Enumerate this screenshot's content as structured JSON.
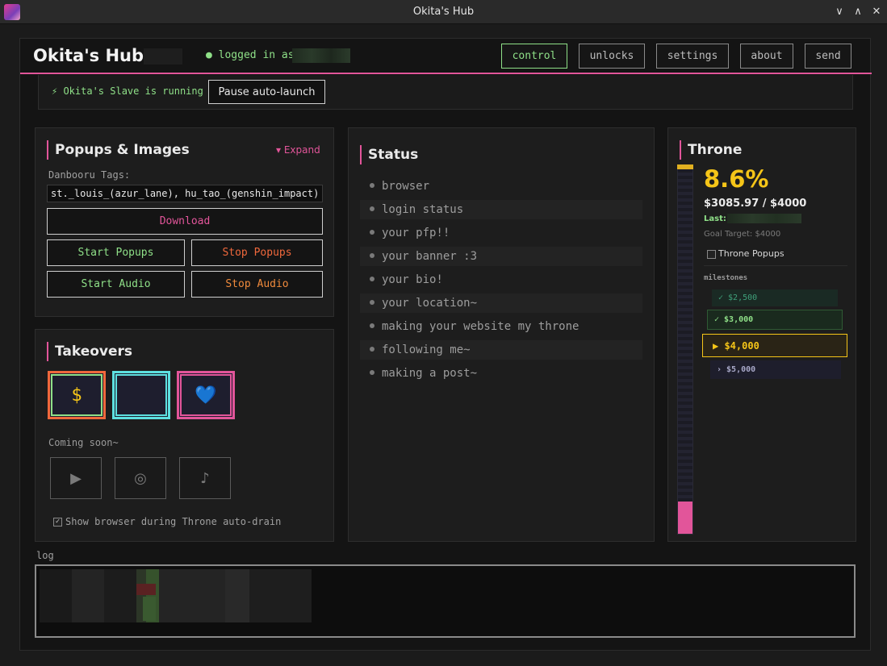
{
  "window": {
    "title": "Okita's Hub",
    "icon": "app-icon",
    "controls": {
      "minimize": "∨",
      "maximize": "∧",
      "close": "✕"
    }
  },
  "header": {
    "brand": "Okita's Hub",
    "login_text": "● logged in as",
    "nav": [
      {
        "label": "control",
        "active": true
      },
      {
        "label": "unlocks",
        "active": false
      },
      {
        "label": "settings",
        "active": false
      },
      {
        "label": "about",
        "active": false
      },
      {
        "label": "send",
        "active": false
      }
    ]
  },
  "runbar": {
    "status": "⚡ Okita's Slave is running",
    "pause_label": "Pause auto-launch"
  },
  "popups": {
    "title": "Popups & Images",
    "expand_label": "▾ Expand",
    "tags_label": "Danbooru Tags:",
    "tags_value": "st._louis_(azur_lane), hu_tao_(genshin_impact)",
    "download_label": "Download",
    "start_popups_label": "Start Popups",
    "stop_popups_label": "Stop Popups",
    "start_audio_label": "Start Audio",
    "stop_audio_label": "Stop Audio",
    "colors": {
      "download": "#e2559a",
      "start": "#8fe088",
      "stop_popups": "#f0683c",
      "stop_audio": "#f08a3c"
    }
  },
  "takeovers": {
    "title": "Takeovers",
    "tiles": [
      {
        "glyph": "$",
        "icon": "dollar-icon",
        "outer": "#f0683c",
        "inner": "#8fe088",
        "color": "#f5c518"
      },
      {
        "glyph": "",
        "icon": "blank-tile",
        "outer": "#5de0e0",
        "inner": "#5de0e0",
        "color": "#ffffff"
      },
      {
        "glyph": "💙",
        "icon": "blue-heart-icon",
        "outer": "#e2559a",
        "inner": "#e2559a",
        "color": "#3a8ee8"
      }
    ],
    "coming_soon": "Coming soon~",
    "soon_tiles": [
      {
        "glyph": "▶",
        "icon": "play-icon"
      },
      {
        "glyph": "◎",
        "icon": "target-icon"
      },
      {
        "glyph": "♪",
        "icon": "music-note-icon"
      }
    ],
    "show_browser_label": "Show browser during Throne auto-drain",
    "show_browser_checked": true
  },
  "status": {
    "title": "Status",
    "items": [
      "browser",
      "login status",
      "your pfp!!",
      "your banner :3",
      "your bio!",
      "your location~",
      "making your website my throne",
      "following me~",
      "making a post~"
    ]
  },
  "throne": {
    "title": "Throne",
    "percent_text": "8.6%",
    "progress_fraction": 0.086,
    "amount_text": "$3085.97 / $4000",
    "last_label": "Last:",
    "goal_text": "Goal Target: $4000",
    "popups_label": "Throne Popups",
    "popups_checked": false,
    "milestones_title": "milestones",
    "milestones": [
      {
        "label": "✓ $2,500",
        "state": "done"
      },
      {
        "label": "✓ $3,000",
        "state": "done"
      },
      {
        "label": "▶ $4,000",
        "state": "current"
      },
      {
        "label": "› $5,000",
        "state": "next"
      }
    ]
  },
  "log": {
    "label": "log"
  }
}
